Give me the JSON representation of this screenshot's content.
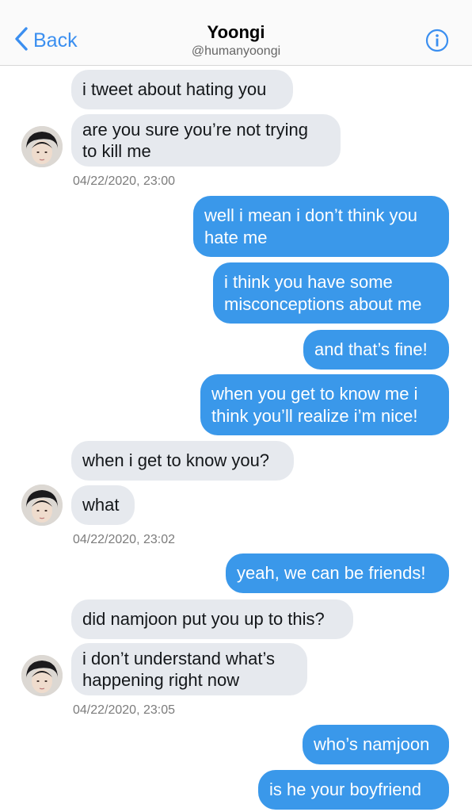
{
  "header": {
    "back_label": "Back",
    "name": "Yoongi",
    "handle": "@humanyoongi",
    "info_icon": "info-circle-icon",
    "back_icon": "chevron-left-icon",
    "accent_color": "#3b8ff0"
  },
  "colors": {
    "incoming_bubble": "#e6e9ee",
    "outgoing_bubble": "#3a98ea"
  },
  "messages": [
    {
      "text": "i tweet about hating you"
    },
    {
      "line1": "are you sure you’re not trying",
      "line2": "to kill me"
    },
    {
      "line1": "well i mean i don’t think you",
      "line2": "hate me"
    },
    {
      "line1": "i think you have some",
      "line2": "misconceptions about me"
    },
    {
      "text": "and that’s fine!"
    },
    {
      "line1": "when you get to know me i",
      "line2": "think you’ll realize i’m nice!"
    },
    {
      "text": "when i get to know you?"
    },
    {
      "text": "what"
    },
    {
      "text": "yeah, we can be friends!"
    },
    {
      "text": "did namjoon put you up to this?"
    },
    {
      "line1": "i don’t understand what’s",
      "line2": "happening right now"
    },
    {
      "text": "who’s namjoon"
    },
    {
      "text": "is he your boyfriend"
    }
  ],
  "timestamps": [
    "04/22/2020, 23:00",
    "04/22/2020, 23:02",
    "04/22/2020, 23:05"
  ]
}
